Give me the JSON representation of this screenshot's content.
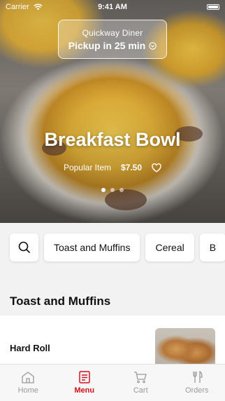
{
  "status": {
    "carrier": "Carrier",
    "time": "9:41 AM"
  },
  "pickup": {
    "restaurant": "Quickway Diner",
    "eta": "Pickup in 25 min"
  },
  "hero": {
    "title": "Breakfast Bowl",
    "tag": "Popular Item",
    "price": "$7.50",
    "dots": 3,
    "active_dot": 0
  },
  "categories": [
    "Toast and Muffins",
    "Cereal",
    "B"
  ],
  "section": {
    "title": "Toast and Muffins"
  },
  "items": [
    {
      "name": "Hard Roll"
    }
  ],
  "tabs": [
    {
      "label": "Home",
      "icon": "home-icon"
    },
    {
      "label": "Menu",
      "icon": "menu-icon",
      "active": true
    },
    {
      "label": "Cart",
      "icon": "cart-icon"
    },
    {
      "label": "Orders",
      "icon": "orders-icon"
    }
  ],
  "colors": {
    "accent": "#d0131d",
    "tab_inactive": "#9a9a9a"
  }
}
